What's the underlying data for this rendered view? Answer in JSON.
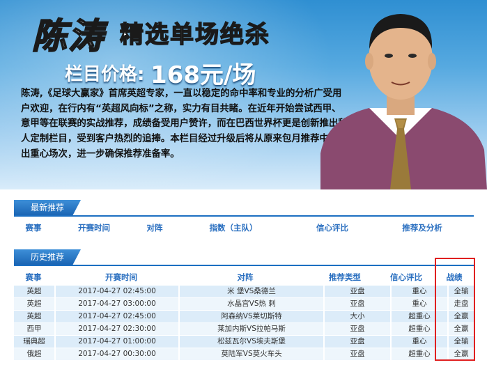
{
  "banner": {
    "name": "陈涛",
    "title": "精选单场绝杀",
    "price_label": "栏目价格:",
    "price_value": "168元/场",
    "description": "陈涛,《足球大赢家》首席英超专家，一直以稳定的命中率和专业的分析广受用户欢迎，在行内有“英超风向标”之称，实力有目共睹。在近年开始尝试西甲、意甲等在联赛的实战推荐，成绩备受用户赞许，而在巴西世界杯更是创新推出私人定制栏目，受到客户热烈的追捧。本栏目经过升级后将从原来包月推荐中精选出重心场次，进一步确保推荐准备率。"
  },
  "latest": {
    "tab_label": "最新推荐",
    "headers": [
      "赛事",
      "开赛时间",
      "对阵",
      "指数（主队）",
      "信心评比",
      "推荐及分析"
    ]
  },
  "history": {
    "tab_label": "历史推荐",
    "headers": [
      "赛事",
      "开赛时间",
      "对阵",
      "推荐类型",
      "信心评比",
      "战绩"
    ],
    "rows": [
      [
        "英超",
        "2017-04-27 02:45:00",
        "米 堡VS桑德兰",
        "亚盘",
        "重心",
        "全输"
      ],
      [
        "英超",
        "2017-04-27 03:00:00",
        "水晶宫VS热 刺",
        "亚盘",
        "重心",
        "走盘"
      ],
      [
        "英超",
        "2017-04-27 02:45:00",
        "阿森纳VS莱切斯特",
        "大小",
        "超重心",
        "全赢"
      ],
      [
        "西甲",
        "2017-04-27 02:30:00",
        "莱加内斯VS拉帕马斯",
        "亚盘",
        "超重心",
        "全赢"
      ],
      [
        "瑞典超",
        "2017-04-27 01:00:00",
        "松兹瓦尔VS埃夫斯堡",
        "亚盘",
        "重心",
        "全输"
      ],
      [
        "俄超",
        "2017-04-27 00:30:00",
        "莫陆军VS莫火车头",
        "亚盘",
        "超重心",
        "全赢"
      ]
    ]
  }
}
